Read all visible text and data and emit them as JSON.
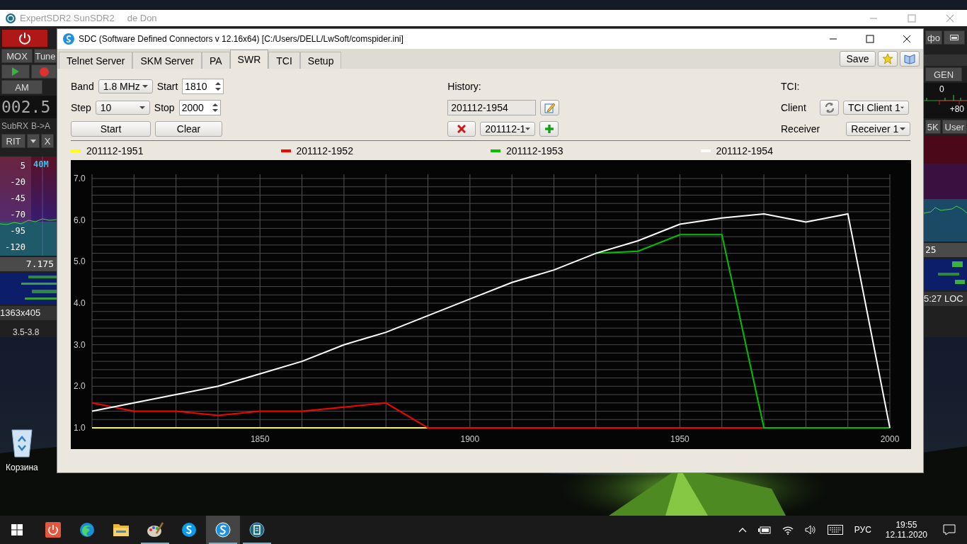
{
  "desktop": {
    "icons": [
      {
        "label": "Корзина"
      }
    ]
  },
  "background_window": {
    "title": "ExpertSDR2 SunSDR2",
    "subtitle": "de Don",
    "left_panel": {
      "top_buttons": [
        "MOX",
        "Tune"
      ],
      "mode_button": "AM",
      "frequency": "002.5",
      "sub_buttons": [
        "SubRX",
        "B->A"
      ],
      "rit_button": "RIT",
      "x_button": "X",
      "scale": [
        "5",
        "-20",
        "-45",
        "-70",
        "-95",
        "-120"
      ],
      "band": "40M",
      "tuned_frequency": "7.175",
      "size": "1363x405",
      "range": "3.5-3.8"
    },
    "right_panel": {
      "partial_button": "фо",
      "mode_button": "GEN",
      "meter_labels": [
        "0",
        "+80"
      ],
      "buttons": [
        "5K",
        "User"
      ],
      "frequency": "25",
      "clock": "5:27 LOC"
    }
  },
  "window": {
    "title": "SDC (Software Defined Connectors v 12.16x64) [C:/Users/DELL/LwSoft/comspider.ini]",
    "tabs": [
      {
        "label": "Telnet Server",
        "selected": false
      },
      {
        "label": "SKM Server",
        "selected": false
      },
      {
        "label": "PA",
        "selected": false
      },
      {
        "label": "SWR",
        "selected": true
      },
      {
        "label": "TCI",
        "selected": false
      },
      {
        "label": "Setup",
        "selected": false
      }
    ],
    "save_button": "Save",
    "sweep": {
      "band": {
        "label": "Band",
        "value": "1.8 MHz"
      },
      "start": {
        "label": "Start",
        "value": "1810"
      },
      "step": {
        "label": "Step",
        "value": "10"
      },
      "stop": {
        "label": "Stop",
        "value": "2000"
      },
      "buttons": [
        "Start",
        "Clear"
      ]
    },
    "history": {
      "label": "History:",
      "name": "201112-1954",
      "selected": "201112-1"
    },
    "tci": {
      "label": "TCI:",
      "client": {
        "label": "Client",
        "value": "TCI Client 1"
      },
      "receiver": {
        "label": "Receiver",
        "value": "Receiver 1"
      }
    },
    "chart_data": {
      "type": "line",
      "grid": true,
      "x": [
        1810,
        1820,
        1830,
        1840,
        1850,
        1860,
        1870,
        1880,
        1890,
        1900,
        1910,
        1920,
        1930,
        1940,
        1950,
        1960,
        1970,
        1980,
        1990,
        2000
      ],
      "xlim": [
        1810,
        2000
      ],
      "ylim": [
        1,
        7
      ],
      "xticks": [
        1850,
        1900,
        1950,
        2000
      ],
      "yticks": [
        {
          "value": 1,
          "label": "1.0"
        },
        {
          "value": 2,
          "label": "2.0"
        },
        {
          "value": 3,
          "label": "3.0"
        },
        {
          "value": 4,
          "label": "4.0"
        },
        {
          "value": 5,
          "label": "5.0"
        },
        {
          "value": 6,
          "label": "6.0"
        },
        {
          "value": 7,
          "label": "7.0"
        }
      ],
      "series": [
        {
          "name": "201112-1951",
          "color": "#ffff00",
          "values": [
            1,
            1,
            1,
            1,
            1,
            1,
            1,
            1,
            1,
            null,
            null,
            null,
            null,
            null,
            null,
            null,
            null,
            null,
            null,
            null
          ]
        },
        {
          "name": "201112-1952",
          "color": "#ff0000",
          "values": [
            1.6,
            1.4,
            1.4,
            1.3,
            1.4,
            1.4,
            1.5,
            1.6,
            1,
            1,
            1,
            1,
            1,
            1,
            1,
            1,
            1,
            null,
            null,
            null
          ]
        },
        {
          "name": "201112-1953",
          "color": "#00c000",
          "values": [
            null,
            null,
            null,
            null,
            null,
            null,
            null,
            null,
            null,
            null,
            null,
            null,
            5.2,
            5.25,
            5.65,
            5.65,
            1,
            1,
            1,
            1
          ]
        },
        {
          "name": "201112-1954",
          "color": "#ffffff",
          "values": [
            1.4,
            1.6,
            1.8,
            2.0,
            2.3,
            2.6,
            3.0,
            3.3,
            3.7,
            4.1,
            4.5,
            4.8,
            5.2,
            5.5,
            5.9,
            6.05,
            6.15,
            5.95,
            6.15,
            1
          ]
        }
      ]
    }
  },
  "taskbar": {
    "apps": [
      {
        "kind": "power",
        "running": false,
        "selected": false
      },
      {
        "kind": "edge",
        "running": false,
        "selected": false
      },
      {
        "kind": "folder",
        "running": false,
        "selected": false
      },
      {
        "kind": "paint",
        "running": true,
        "selected": false
      },
      {
        "kind": "skype",
        "running": false,
        "selected": false
      },
      {
        "kind": "sdc",
        "running": true,
        "selected": true
      },
      {
        "kind": "app",
        "running": true,
        "selected": false
      }
    ],
    "language": "РУС",
    "time": "19:55",
    "date": "12.11.2020"
  }
}
